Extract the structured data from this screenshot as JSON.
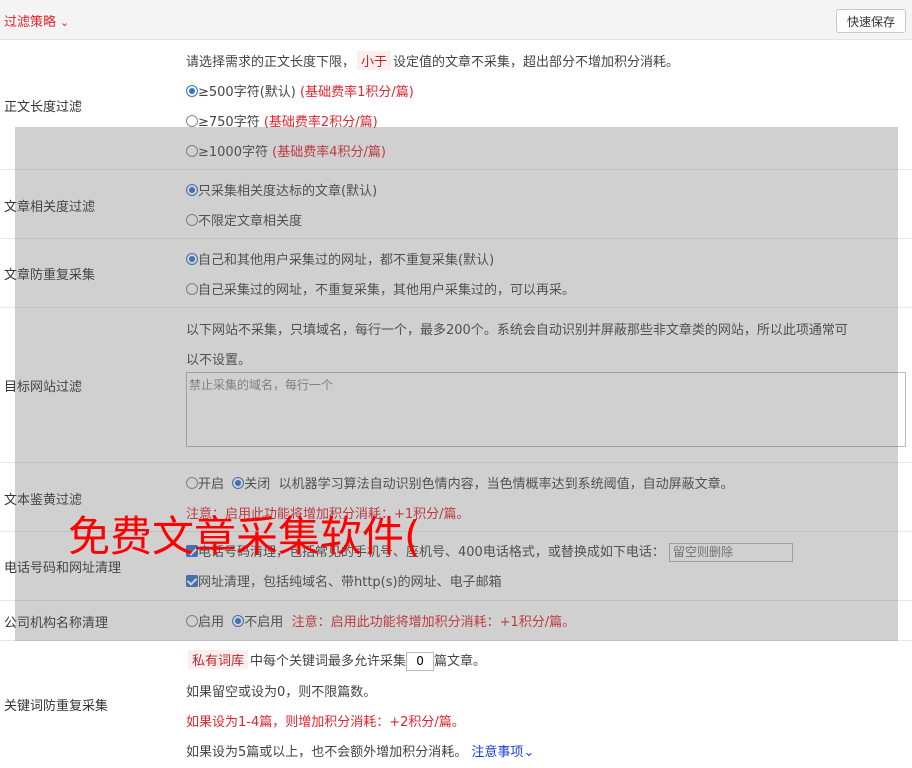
{
  "header": {
    "title": "过滤策略",
    "save_label": "快速保存"
  },
  "length_filter": {
    "label": "正文长度过滤",
    "desc_pre": "请选择需求的正文长度下限，",
    "desc_tag": "小于",
    "desc_post": "设定值的文章不采集，超出部分不增加积分消耗。",
    "options": [
      {
        "text": "≥500字符(默认)",
        "note": "(基础费率1积分/篇)",
        "selected": true
      },
      {
        "text": "≥750字符",
        "note": "(基础费率2积分/篇)",
        "selected": false
      },
      {
        "text": "≥1000字符",
        "note": "(基础费率4积分/篇)",
        "selected": false
      }
    ]
  },
  "relevance_filter": {
    "label": "文章相关度过滤",
    "options": [
      {
        "text": "只采集相关度达标的文章(默认)",
        "selected": true
      },
      {
        "text": "不限定文章相关度",
        "selected": false
      }
    ]
  },
  "dedupe_filter": {
    "label": "文章防重复采集",
    "options": [
      {
        "text": "自己和其他用户采集过的网址，都不重复采集(默认)",
        "selected": true
      },
      {
        "text": "自己采集过的网址，不重复采集，其他用户采集过的，可以再采。",
        "selected": false
      }
    ]
  },
  "site_filter": {
    "label": "目标网站过滤",
    "desc_line1": "以下网站不采集，只填域名，每行一个，最多200个。系统会自动识别并屏蔽那些非文章类的网站，所以此项通常可",
    "desc_line2": "以不设置。",
    "placeholder": "禁止采集的域名，每行一个"
  },
  "porn_filter": {
    "label": "文本鉴黄过滤",
    "on_label": "开启",
    "off_label": "关闭",
    "selected": "off",
    "desc": "以机器学习算法自动识别色情内容，当色情概率达到系统阈值，自动屏蔽文章。",
    "note": "注意：启用此功能将增加积分消耗：+1积分/篇。"
  },
  "contact_clean": {
    "label": "电话号码和网址清理",
    "phone_text": "电话号码清理，包括常见的手机号、座机号、400电话格式，或替换成如下电话：",
    "phone_placeholder": "留空则删除",
    "url_text": "网址清理，包括纯域名、带http(s)的网址、电子邮箱"
  },
  "company_clean": {
    "label": "公司机构名称清理",
    "on_label": "启用",
    "off_label": "不启用",
    "selected": "off",
    "note": "注意：启用此功能将增加积分消耗：+1积分/篇。"
  },
  "keyword_dedupe": {
    "label": "关键词防重复采集",
    "tag": "私有词库",
    "line1_mid": "中每个关键词最多允许采集",
    "count": "0",
    "line1_post": "篇文章。",
    "line2": "如果留空或设为0，则不限篇数。",
    "line3": "如果设为1-4篇，则增加积分消耗：+2积分/篇。",
    "line4": "如果设为5篇或以上，也不会额外增加积分消耗。",
    "link": "注意事项"
  },
  "watermark": "免费文章采集软件(",
  "colors": {
    "accent_red": "#e0252f",
    "radio_blue": "#3072d1",
    "link_blue": "#1a3fd6"
  }
}
